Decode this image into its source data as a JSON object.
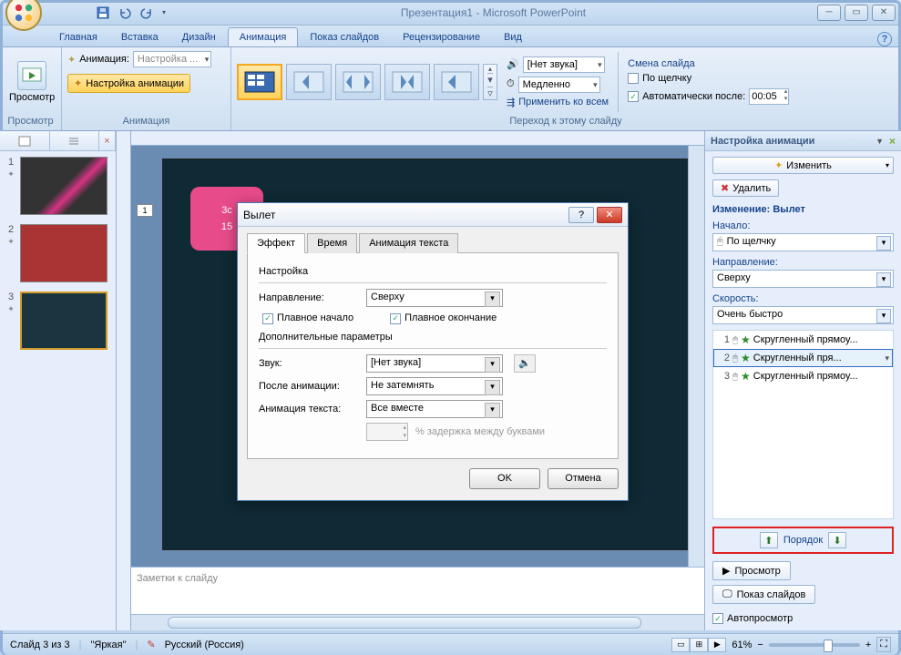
{
  "titlebar": {
    "title": "Презентация1 - Microsoft PowerPoint"
  },
  "tabs": [
    "Главная",
    "Вставка",
    "Дизайн",
    "Анимация",
    "Показ слайдов",
    "Рецензирование",
    "Вид"
  ],
  "active_tab": 3,
  "ribbon": {
    "preview": {
      "label": "Просмотр",
      "group": "Просмотр"
    },
    "animation_group": {
      "label": "Анимация",
      "anim_label": "Анимация:",
      "anim_combo": "Настройка ...",
      "custom_btn": "Настройка анимации"
    },
    "transition_group": {
      "label": "Переход к этому слайду",
      "sound_combo": "[Нет звука]",
      "speed_combo": "Медленно",
      "apply_all": "Применить ко всем",
      "advance_header": "Смена слайда",
      "on_click": "По щелчку",
      "auto_after": "Автоматически после:",
      "auto_value": "00:05",
      "on_click_checked": false,
      "auto_checked": true
    }
  },
  "thumbs": [
    "1",
    "2",
    "3"
  ],
  "selected_thumb": 2,
  "slide": {
    "obj_label1": "3с",
    "obj_label2": "15",
    "handle": "1"
  },
  "notes_placeholder": "Заметки к слайду",
  "dialog": {
    "title": "Вылет",
    "tabs": [
      "Эффект",
      "Время",
      "Анимация текста"
    ],
    "active": 0,
    "sect_settings": "Настройка",
    "direction_label": "Направление:",
    "direction_value": "Сверху",
    "smooth_start": "Плавное начало",
    "smooth_end": "Плавное окончание",
    "smooth_start_checked": true,
    "smooth_end_checked": true,
    "sect_extra": "Дополнительные параметры",
    "sound_label": "Звук:",
    "sound_value": "[Нет звука]",
    "after_label": "После анимации:",
    "after_value": "Не затемнять",
    "text_label": "Анимация текста:",
    "text_value": "Все вместе",
    "delay_hint": "% задержка между буквами",
    "ok": "OK",
    "cancel": "Отмена"
  },
  "taskpane": {
    "title": "Настройка анимации",
    "change_btn": "Изменить",
    "delete_btn": "Удалить",
    "modify_header": "Изменение: Вылет",
    "start_label": "Начало:",
    "start_value": "По щелчку",
    "dir_label": "Направление:",
    "dir_value": "Сверху",
    "speed_label": "Скорость:",
    "speed_value": "Очень быстро",
    "items": [
      {
        "n": "1",
        "name": "Скругленный прямоу..."
      },
      {
        "n": "2",
        "name": "Скругленный пря..."
      },
      {
        "n": "3",
        "name": "Скругленный прямоу..."
      }
    ],
    "selected": 1,
    "order_label": "Порядок",
    "play": "Просмотр",
    "slideshow": "Показ слайдов",
    "autopreview": "Автопросмотр",
    "autopreview_checked": true
  },
  "status": {
    "slide": "Слайд 3 из 3",
    "theme": "\"Яркая\"",
    "lang": "Русский (Россия)",
    "zoom": "61%"
  }
}
